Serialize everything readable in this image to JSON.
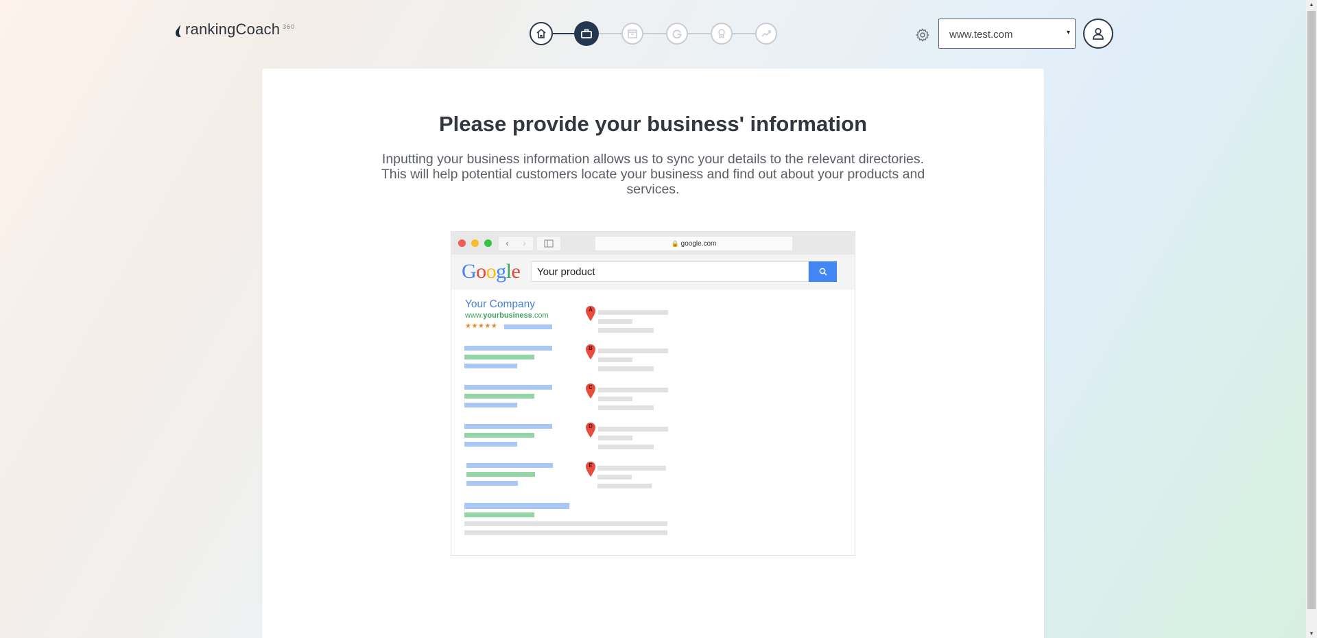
{
  "header": {
    "logo_text": "rankingCoach",
    "logo_sup": "360",
    "steps": [
      {
        "name": "home",
        "state": "done"
      },
      {
        "name": "business",
        "state": "active"
      },
      {
        "name": "directory",
        "state": "todo"
      },
      {
        "name": "google",
        "state": "todo"
      },
      {
        "name": "award",
        "state": "todo"
      },
      {
        "name": "trend",
        "state": "todo"
      }
    ],
    "site_select": {
      "value": "www.test.com",
      "caret": "▾"
    }
  },
  "main": {
    "title": "Please provide your business' information",
    "description_line1": "Inputting your business information allows us to sync your details to the relevant directories.",
    "description_line2": "This will help potential customers locate your business and find out about your products and",
    "description_line3": "services."
  },
  "illustration": {
    "url": "google.com",
    "search_logo": "Google",
    "search_query": "Your product",
    "company_name": "Your Company",
    "company_url_prefix": "www.",
    "company_url_bold": "yourbusiness",
    "company_url_suffix": ".com",
    "stars": "★★★★★",
    "pins": [
      "A",
      "B",
      "C",
      "D",
      "E"
    ]
  },
  "colors": {
    "accent_dark": "#23374f",
    "google_blue": "#4285f4",
    "pin_red": "#e84c3d"
  }
}
